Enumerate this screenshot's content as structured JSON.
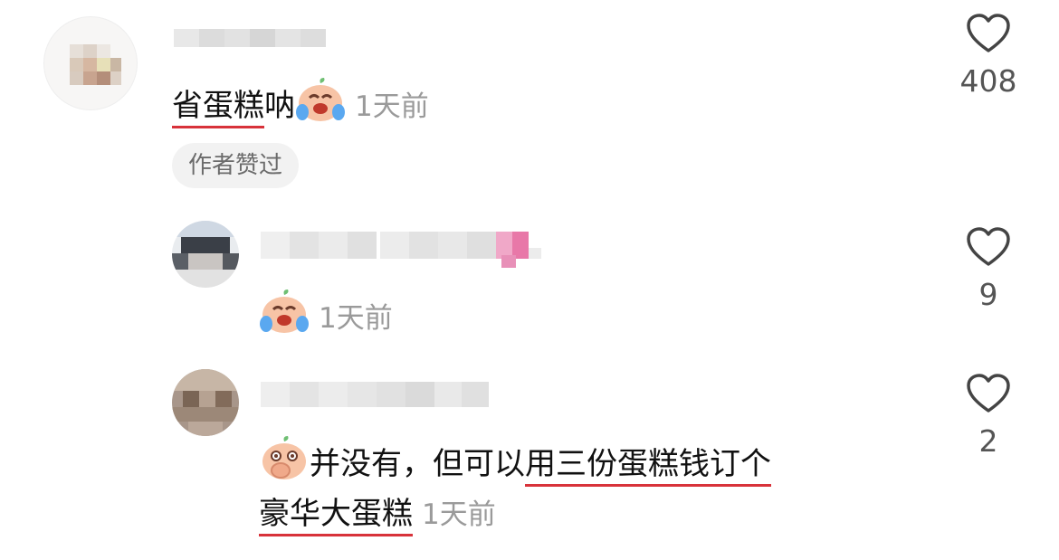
{
  "comments": [
    {
      "text_underlined": "省蛋糕",
      "text_rest": "呐",
      "time": "1天前",
      "badge": "作者赞过",
      "likes": "408"
    },
    {
      "time": "1天前",
      "likes": "9"
    },
    {
      "line1_plain": "并没有，但可以",
      "line1_underlined": "用三份蛋糕钱订个",
      "line2_underlined": "豪华大蛋糕",
      "time": "1天前",
      "likes": "2"
    }
  ],
  "colors": {
    "underline": "#d8323a",
    "time": "#9a9a9a",
    "badge_bg": "#f2f2f2"
  }
}
